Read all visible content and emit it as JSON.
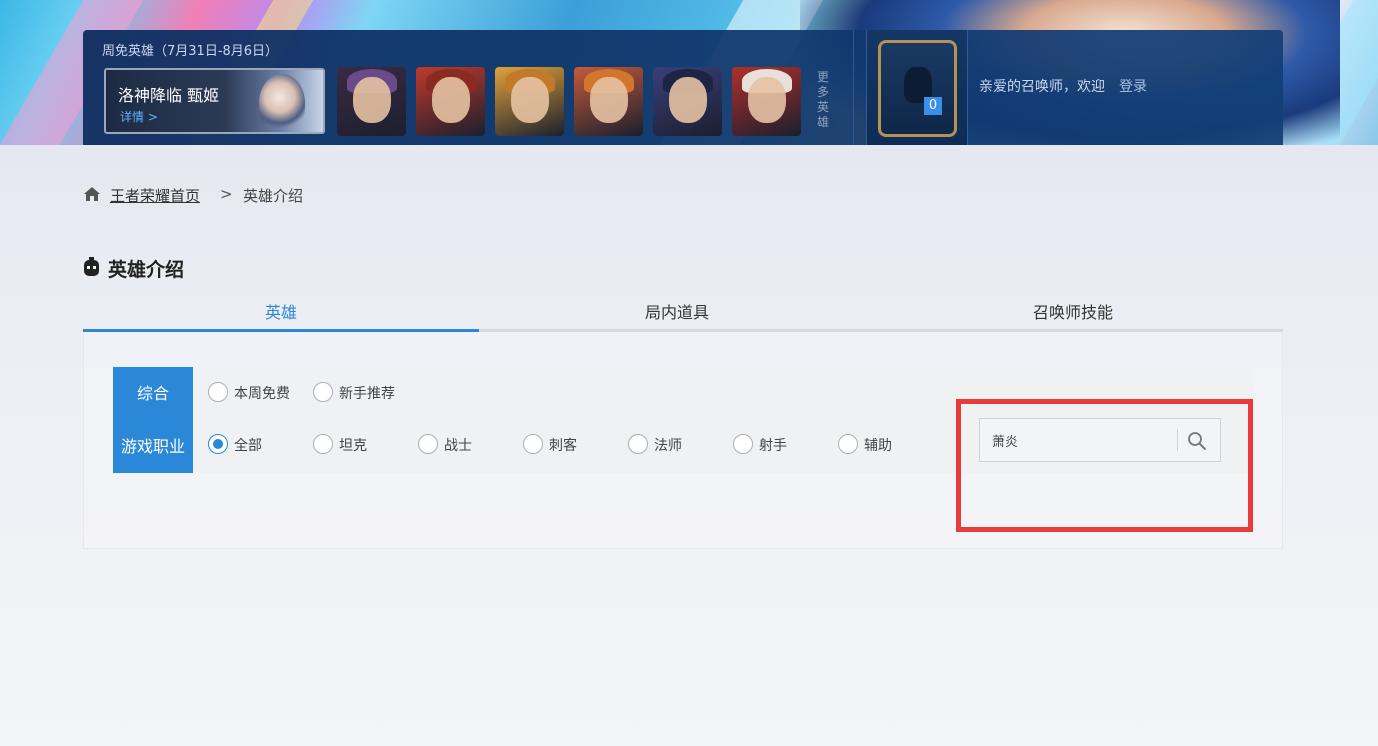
{
  "header": {
    "free_heroes_title": "周免英雄（7月31日-8月6日）",
    "promo": {
      "title": "洛神降临 甄姬",
      "link_label": "详情 >"
    },
    "hero_thumbnails": [
      {
        "name": "hero-1",
        "hair": "#6b4a8a",
        "bg": "#3b2a44"
      },
      {
        "name": "hero-2",
        "hair": "#8a2a22",
        "bg": "#c03a2a"
      },
      {
        "name": "hero-3",
        "hair": "#c07a2a",
        "bg": "#e0a23a"
      },
      {
        "name": "hero-4",
        "hair": "#d2762e",
        "bg": "#c45a3a"
      },
      {
        "name": "hero-5",
        "hair": "#1e2444",
        "bg": "#3a3f7a"
      },
      {
        "name": "hero-6",
        "hair": "#e8e0da",
        "bg": "#b0302a"
      }
    ],
    "more_heroes_label": "更多英雄",
    "avatar_count": "0",
    "welcome_text": "亲爱的召唤师，欢迎",
    "login_label": "登录"
  },
  "breadcrumb": {
    "home_label": "王者荣耀首页",
    "separator": ">",
    "current_label": "英雄介绍"
  },
  "section": {
    "title": "英雄介绍"
  },
  "tabs": [
    {
      "label": "英雄",
      "active": true
    },
    {
      "label": "局内道具",
      "active": false
    },
    {
      "label": "召唤师技能",
      "active": false
    }
  ],
  "filters": {
    "general": {
      "label": "综合",
      "options": [
        {
          "label": "本周免费",
          "checked": false
        },
        {
          "label": "新手推荐",
          "checked": false
        }
      ]
    },
    "role": {
      "label": "游戏职业",
      "options": [
        {
          "label": "全部",
          "checked": true
        },
        {
          "label": "坦克",
          "checked": false
        },
        {
          "label": "战士",
          "checked": false
        },
        {
          "label": "刺客",
          "checked": false
        },
        {
          "label": "法师",
          "checked": false
        },
        {
          "label": "射手",
          "checked": false
        },
        {
          "label": "辅助",
          "checked": false
        }
      ]
    }
  },
  "search": {
    "value": "萧炎",
    "placeholder": ""
  },
  "colors": {
    "accent": "#2b87d8",
    "highlight": "#ea3b3b",
    "header_panel": "#0e2e60"
  }
}
